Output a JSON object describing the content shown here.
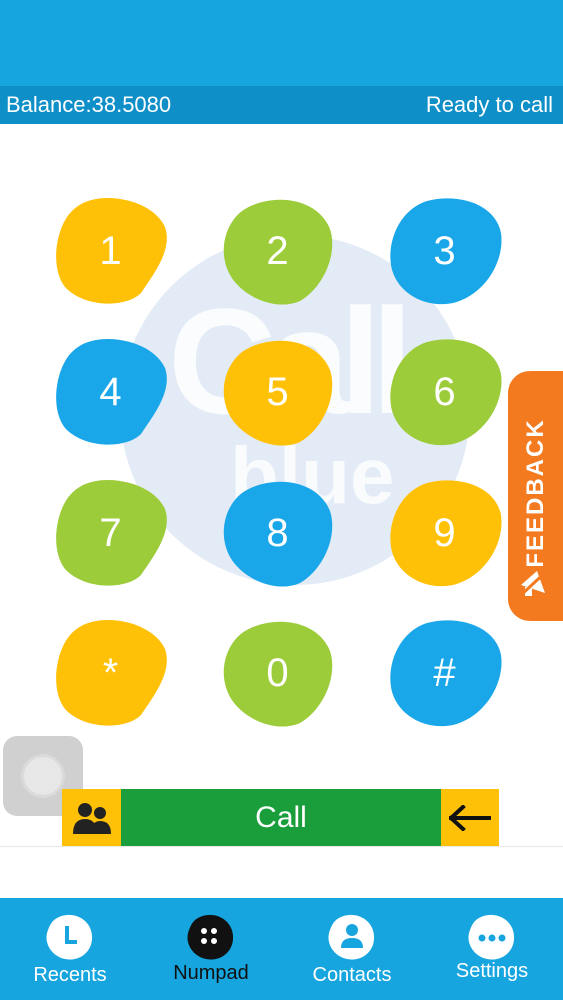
{
  "status": {
    "balance": "Balance:38.5080",
    "state": "Ready to call"
  },
  "watermark": {
    "logo": "Call",
    "sub": "blue"
  },
  "colors": {
    "yellow": "#ffc107",
    "green": "#9ccc3a",
    "blue": "#1aa7ea",
    "orange": "#f47a20",
    "call_green": "#1a9e3b",
    "bar_blue": "#16a5df"
  },
  "keypad": [
    {
      "label": "1",
      "color": "yellow"
    },
    {
      "label": "2",
      "color": "green"
    },
    {
      "label": "3",
      "color": "blue"
    },
    {
      "label": "4",
      "color": "blue"
    },
    {
      "label": "5",
      "color": "yellow"
    },
    {
      "label": "6",
      "color": "green"
    },
    {
      "label": "7",
      "color": "green"
    },
    {
      "label": "8",
      "color": "blue"
    },
    {
      "label": "9",
      "color": "yellow"
    },
    {
      "label": "*",
      "color": "yellow"
    },
    {
      "label": "0",
      "color": "green"
    },
    {
      "label": "#",
      "color": "blue"
    }
  ],
  "feedback": {
    "label": "FEEDBACK",
    "icon": "megaphone-icon"
  },
  "call_bar": {
    "call_label": "Call",
    "contacts_icon": "people-icon",
    "backspace_icon": "arrow-left-icon"
  },
  "tabs": [
    {
      "label": "Recents",
      "icon": "clock-icon",
      "active": false
    },
    {
      "label": "Numpad",
      "icon": "dialpad-icon",
      "active": true
    },
    {
      "label": "Contacts",
      "icon": "person-icon",
      "active": false
    },
    {
      "label": "Settings",
      "icon": "more-icon",
      "active": false
    }
  ]
}
